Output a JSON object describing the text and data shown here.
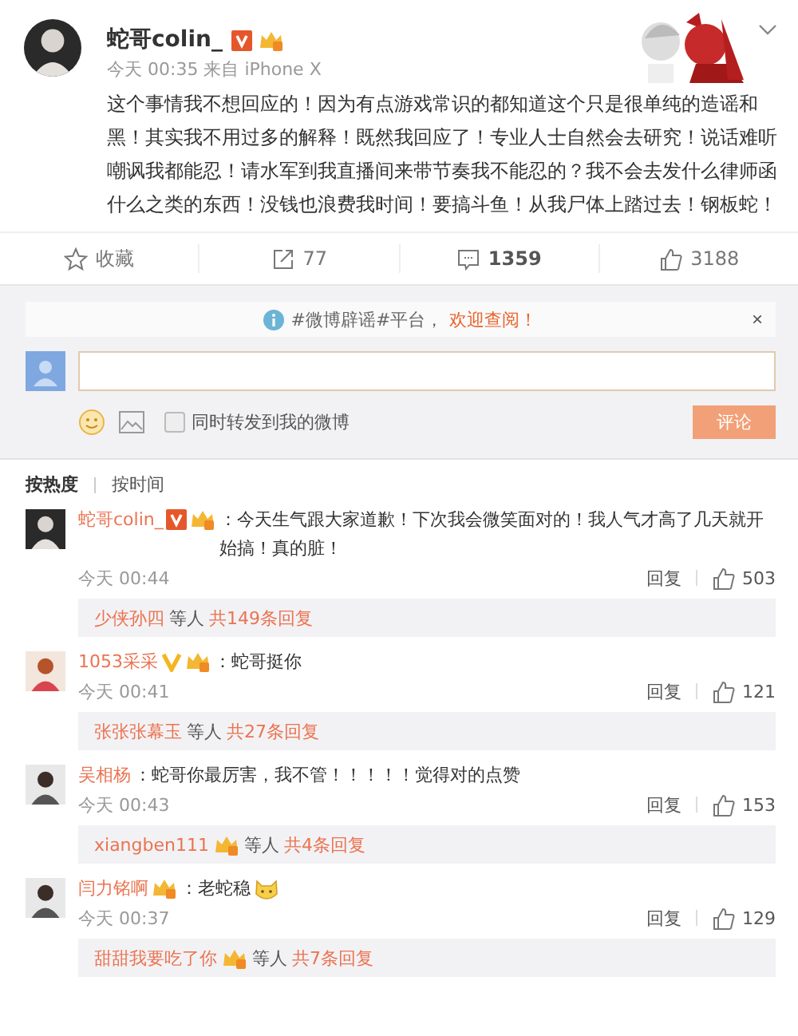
{
  "post": {
    "author": "蛇哥colin_",
    "verified": true,
    "vip": true,
    "meta": "今天 00:35 来自 iPhone X",
    "text": "这个事情我不想回应的！因为有点游戏常识的都知道这个只是很单纯的造谣和黑！其实我不用过多的解释！既然我回应了！专业人士自然会去研究！说话难听嘲讽我都能忍！请水军到我直播间来带节奏我不能忍的？我不会去发什么律师函什么之类的东西！没钱也浪费我时间！要搞斗鱼！从我尸体上踏过去！钢板蛇！"
  },
  "actions": [
    {
      "kind": "favorite",
      "label": "收藏",
      "selected": false
    },
    {
      "kind": "repost",
      "label": "77",
      "selected": false
    },
    {
      "kind": "comment",
      "label": "1359",
      "selected": true
    },
    {
      "kind": "like",
      "label": "3188",
      "selected": false
    }
  ],
  "notice": {
    "text": "#微博辟谣#平台，",
    "link": "欢迎查阅！",
    "close": "×"
  },
  "composer": {
    "repost_label": "同时转发到我的微博",
    "repost_checked": false,
    "submit": "评论",
    "submit_disabled": true
  },
  "sort_tabs": [
    {
      "label": "按热度",
      "selected": true
    },
    {
      "label": "按时间",
      "selected": false
    }
  ],
  "comments": [
    {
      "author": "蛇哥colin_",
      "verified": true,
      "vip": true,
      "text": "：今天生气跟大家道歉！下次我会微笑面对的！我人气才高了几天就开始搞！真的脏！",
      "time": "今天 00:44",
      "reply": "回复",
      "likes": "503",
      "thread": {
        "name": "少侠孙四",
        "others": "等人",
        "count": "共149条回复"
      }
    },
    {
      "author": "1053采采",
      "verified": true,
      "verified_plain": true,
      "vip": true,
      "text": "：蛇哥挺你",
      "time": "今天 00:41",
      "reply": "回复",
      "likes": "121",
      "thread": {
        "name": "张张张幕玉",
        "others": "等人",
        "count": "共27条回复"
      }
    },
    {
      "author": "吴相杨",
      "text": "：蛇哥你最厉害，我不管！！！！！觉得对的点赞",
      "time": "今天 00:43",
      "reply": "回复",
      "likes": "153",
      "thread": {
        "name": "xiangben111",
        "vip": true,
        "others": "等人",
        "count": "共4条回复"
      }
    },
    {
      "author": "闫力铭啊",
      "vip": true,
      "text": "：老蛇稳",
      "emoji": true,
      "time": "今天 00:37",
      "reply": "回复",
      "likes": "129",
      "thread": {
        "name": "甜甜我要吃了你",
        "vip": true,
        "others": "等人",
        "count": "共7条回复"
      }
    }
  ]
}
